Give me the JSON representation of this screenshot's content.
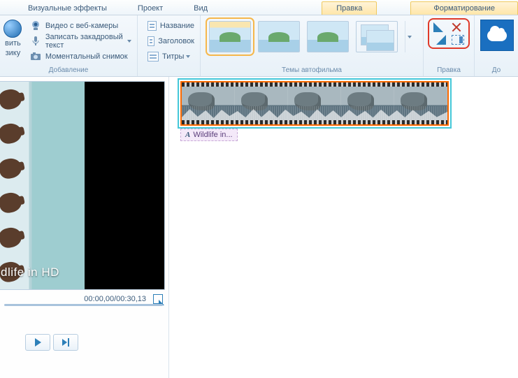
{
  "tabs": {
    "visual_effects": "Визуальные эффекты",
    "project": "Проект",
    "view": "Вид",
    "edit": "Правка",
    "formatting": "Форматирование"
  },
  "ribbon": {
    "big_insert": {
      "label_top": "вить",
      "label_bottom": "зику"
    },
    "record": {
      "webcam": "Видео с веб-камеры",
      "narration": "Записать закадровый текст",
      "snapshot": "Моментальный снимок"
    },
    "captions": {
      "title_label": "Название",
      "header_label": "Заголовок",
      "credits_label": "Титры"
    },
    "group_add": "Добавление",
    "group_themes": "Темы автофильма",
    "group_edit": "Правка",
    "group_share": "До"
  },
  "preview": {
    "overlay_text": "dlife in HD",
    "timecode": "00:00,00/00:30,13"
  },
  "timeline": {
    "clip_title": "Wildlife in..."
  }
}
